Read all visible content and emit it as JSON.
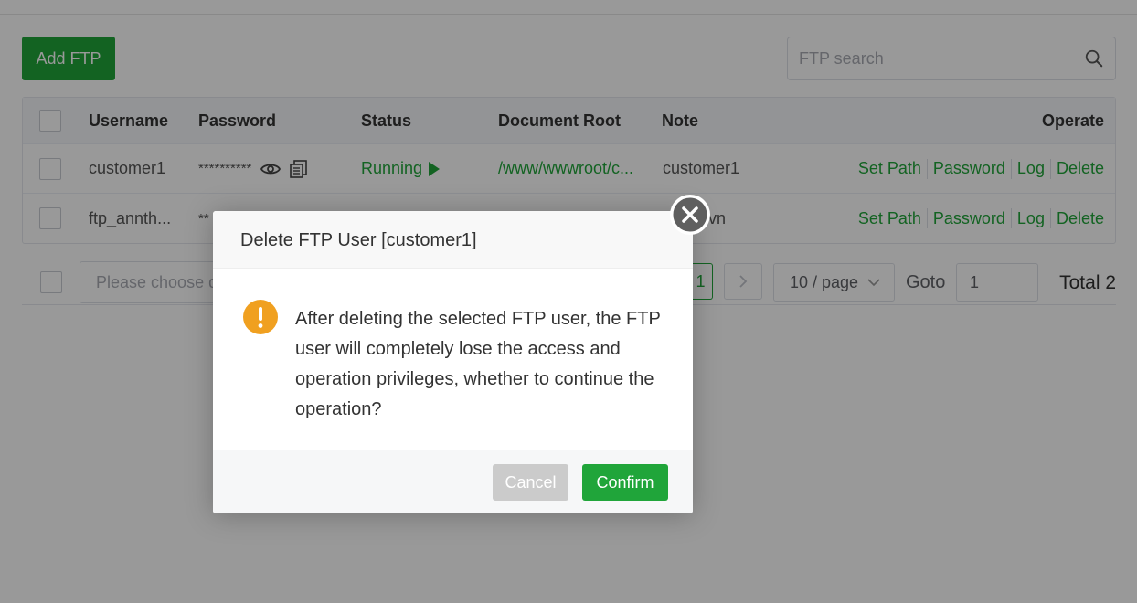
{
  "toolbar": {
    "add_label": "Add FTP"
  },
  "search": {
    "placeholder": "FTP search"
  },
  "table": {
    "headers": {
      "username": "Username",
      "password": "Password",
      "status": "Status",
      "doc_root": "Document Root",
      "note": "Note",
      "operate": "Operate"
    },
    "rows": [
      {
        "username": "customer1",
        "password": "**********",
        "status": "Running",
        "doc_root": "/www/wwwroot/c...",
        "note": "customer1",
        "ops": [
          "Set Path",
          "Password",
          "Log",
          "Delete"
        ]
      },
      {
        "username": "ftp_annth...",
        "password": "**",
        "note_partial": "o.vn",
        "ops": [
          "Set Path",
          "Password",
          "Log",
          "Delete"
        ]
      }
    ]
  },
  "pagination": {
    "batch_placeholder": "Please choose d",
    "current_page": "1",
    "page_size": "10 / page",
    "goto_label": "Goto",
    "goto_value": "1",
    "total": "Total 2"
  },
  "dialog": {
    "title": "Delete FTP User [customer1]",
    "message": "After deleting the selected FTP user, the FTP user will completely lose the access and operation privileges, whether to continue the operation?",
    "cancel_label": "Cancel",
    "confirm_label": "Confirm"
  },
  "colors": {
    "accent": "#20a53a",
    "warning": "#f0a020",
    "overlay": "rgba(0,0,0,0.4)"
  }
}
